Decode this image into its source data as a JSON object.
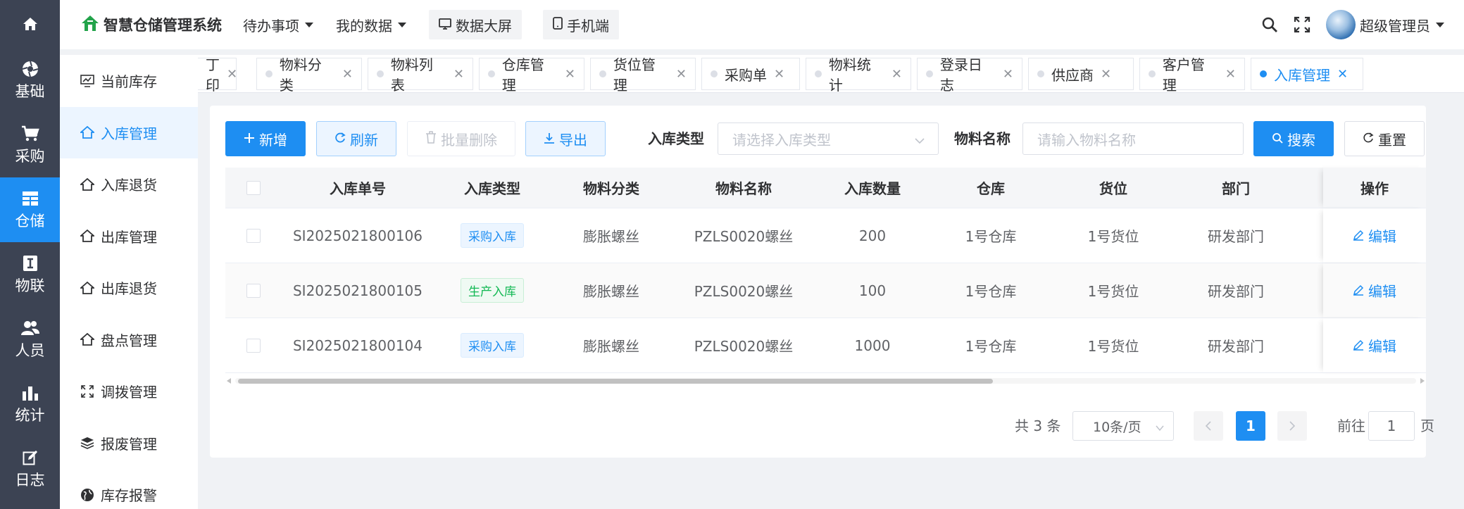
{
  "rail": {
    "items": [
      {
        "label": "基础",
        "icon": "aperture-icon"
      },
      {
        "label": "采购",
        "icon": "cart-icon"
      },
      {
        "label": "仓储",
        "icon": "grid-icon"
      },
      {
        "label": "物联",
        "icon": "device-icon"
      },
      {
        "label": "人员",
        "icon": "users-icon"
      },
      {
        "label": "统计",
        "icon": "bar-chart-icon"
      },
      {
        "label": "日志",
        "icon": "edit-log-icon"
      }
    ],
    "active": "仓储"
  },
  "header": {
    "brand": "智慧仓储管理系统",
    "nav": [
      "待办事项",
      "我的数据"
    ],
    "buttons": [
      "数据大屏",
      "手机端"
    ],
    "user_name": "超级管理员"
  },
  "subnav": {
    "items": [
      "当前库存",
      "入库管理",
      "入库退货",
      "出库管理",
      "出库退货",
      "盘点管理",
      "调拨管理",
      "报废管理",
      "库存报警"
    ],
    "active": "入库管理"
  },
  "tabs": {
    "items": [
      "打印",
      "物料分类",
      "物料列表",
      "仓库管理",
      "货位管理",
      "采购单",
      "物料统计",
      "登录日志",
      "供应商",
      "客户管理",
      "入库管理"
    ],
    "partial_first": "丁印",
    "active": "入库管理"
  },
  "toolbar": {
    "add": "新增",
    "refresh": "刷新",
    "batch_delete": "批量删除",
    "export": "导出",
    "type_label": "入库类型",
    "type_placeholder": "请选择入库类型",
    "name_label": "物料名称",
    "name_placeholder": "请输入物料名称",
    "search": "搜索",
    "reset": "重置"
  },
  "table": {
    "columns": [
      "入库单号",
      "入库类型",
      "物料分类",
      "物料名称",
      "入库数量",
      "仓库",
      "货位",
      "部门",
      "操作"
    ],
    "rows": [
      {
        "no": "SI2025021800106",
        "type": "采购入库",
        "type_color": "blue",
        "category": "膨胀螺丝",
        "name": "PZLS0020螺丝",
        "qty": "200",
        "warehouse": "1号仓库",
        "location": "1号货位",
        "dept": "研发部门",
        "action": "编辑"
      },
      {
        "no": "SI2025021800105",
        "type": "生产入库",
        "type_color": "green",
        "category": "膨胀螺丝",
        "name": "PZLS0020螺丝",
        "qty": "100",
        "warehouse": "1号仓库",
        "location": "1号货位",
        "dept": "研发部门",
        "action": "编辑"
      },
      {
        "no": "SI2025021800104",
        "type": "采购入库",
        "type_color": "blue",
        "category": "膨胀螺丝",
        "name": "PZLS0020螺丝",
        "qty": "1000",
        "warehouse": "1号仓库",
        "location": "1号货位",
        "dept": "研发部门",
        "action": "编辑"
      }
    ]
  },
  "pagination": {
    "total": "共 3 条",
    "page_size": "10条/页",
    "current": "1",
    "goto_label": "前往",
    "goto_value": "1",
    "goto_unit": "页"
  },
  "colors": {
    "primary": "#1e8ef2",
    "rail_bg": "#3c4353",
    "brand_green": "#22a34a",
    "tag_green": "#13b954"
  }
}
